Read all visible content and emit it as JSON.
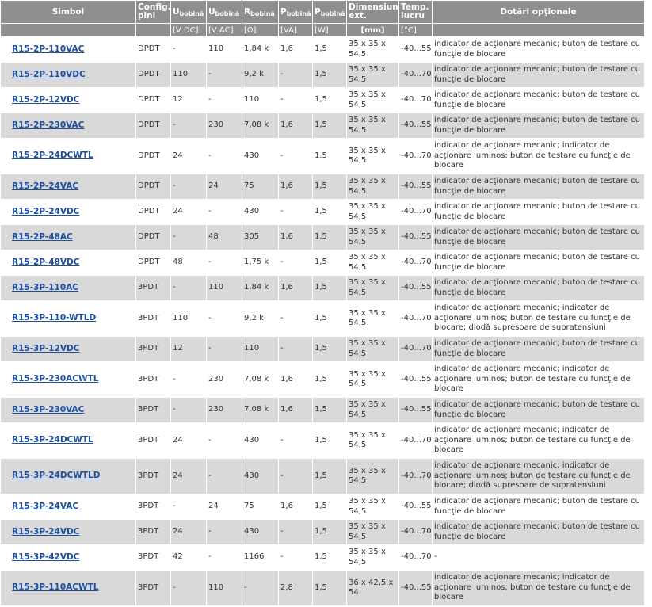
{
  "header": {
    "simbol": "Simbol",
    "config": "Config. pini",
    "u_dc_main": "U",
    "u_dc_sub": "bobină",
    "u_ac_main": "U",
    "u_ac_sub": "bobină",
    "r_main": "R",
    "r_sub": "bobină",
    "p_va_main": "P",
    "p_va_sub": "bobină",
    "p_w_main": "P",
    "p_w_sub": "bobină",
    "dim": "Dimensiuni ext.",
    "temp": "Temp. lucru",
    "dotari": "Dotări opţionale"
  },
  "units": {
    "simbol": "",
    "config": "",
    "u_dc": "[V DC]",
    "u_ac": "[V AC]",
    "r": "[Ω]",
    "p_va": "[VA]",
    "p_w": "[W]",
    "dim": "[mm]",
    "temp": "[°C]",
    "dotari": ""
  },
  "rows": [
    {
      "simbol": "R15-2P-110VAC",
      "config": "DPDT",
      "u_dc": "-",
      "u_ac": "110",
      "r": "1,84 k",
      "p_va": "1,6",
      "p_w": "1,5",
      "dim": "35 x 35 x 54,5",
      "temp": "-40...55",
      "dotari": "indicator de acţionare mecanic; buton de testare cu funcţie de blocare"
    },
    {
      "simbol": "R15-2P-110VDC",
      "config": "DPDT",
      "u_dc": "110",
      "u_ac": "-",
      "r": "9,2 k",
      "p_va": "-",
      "p_w": "1,5",
      "dim": "35 x 35 x 54,5",
      "temp": "-40...70",
      "dotari": "indicator de acţionare mecanic; buton de testare cu funcţie de blocare"
    },
    {
      "simbol": "R15-2P-12VDC",
      "config": "DPDT",
      "u_dc": "12",
      "u_ac": "-",
      "r": "110",
      "p_va": "-",
      "p_w": "1,5",
      "dim": "35 x 35 x 54,5",
      "temp": "-40...70",
      "dotari": "indicator de acţionare mecanic; buton de testare cu funcţie de blocare"
    },
    {
      "simbol": "R15-2P-230VAC",
      "config": "DPDT",
      "u_dc": "-",
      "u_ac": "230",
      "r": "7,08 k",
      "p_va": "1,6",
      "p_w": "1,5",
      "dim": "35 x 35 x 54,5",
      "temp": "-40...55",
      "dotari": "indicator de acţionare mecanic; buton de testare cu funcţie de blocare"
    },
    {
      "simbol": "R15-2P-24DCWTL",
      "config": "DPDT",
      "u_dc": "24",
      "u_ac": "-",
      "r": "430",
      "p_va": "-",
      "p_w": "1,5",
      "dim": "35 x 35 x 54,5",
      "temp": "-40...70",
      "dotari": "indicator de acţionare mecanic; indicator de acţionare luminos; buton de testare cu funcţie de blocare"
    },
    {
      "simbol": "R15-2P-24VAC",
      "config": "DPDT",
      "u_dc": "-",
      "u_ac": "24",
      "r": "75",
      "p_va": "1,6",
      "p_w": "1,5",
      "dim": "35 x 35 x 54,5",
      "temp": "-40...55",
      "dotari": "indicator de acţionare mecanic; buton de testare cu funcţie de blocare"
    },
    {
      "simbol": "R15-2P-24VDC",
      "config": "DPDT",
      "u_dc": "24",
      "u_ac": "-",
      "r": "430",
      "p_va": "-",
      "p_w": "1,5",
      "dim": "35 x 35 x 54,5",
      "temp": "-40...70",
      "dotari": "indicator de acţionare mecanic; buton de testare cu funcţie de blocare"
    },
    {
      "simbol": "R15-2P-48AC",
      "config": "DPDT",
      "u_dc": "-",
      "u_ac": "48",
      "r": "305",
      "p_va": "1,6",
      "p_w": "1,5",
      "dim": "35 x 35 x 54,5",
      "temp": "-40...55",
      "dotari": "indicator de acţionare mecanic; buton de testare cu funcţie de blocare"
    },
    {
      "simbol": "R15-2P-48VDC",
      "config": "DPDT",
      "u_dc": "48",
      "u_ac": "-",
      "r": "1,75 k",
      "p_va": "-",
      "p_w": "1,5",
      "dim": "35 x 35 x 54,5",
      "temp": "-40...70",
      "dotari": "indicator de acţionare mecanic; buton de testare cu funcţie de blocare"
    },
    {
      "simbol": "R15-3P-110AC",
      "config": "3PDT",
      "u_dc": "-",
      "u_ac": "110",
      "r": "1,84 k",
      "p_va": "1,6",
      "p_w": "1,5",
      "dim": "35 x 35 x 54,5",
      "temp": "-40...55",
      "dotari": "indicator de acţionare mecanic; buton de testare cu funcţie de blocare"
    },
    {
      "simbol": "R15-3P-110-WTLD",
      "config": "3PDT",
      "u_dc": "110",
      "u_ac": "-",
      "r": "9,2 k",
      "p_va": "-",
      "p_w": "1,5",
      "dim": "35 x 35 x 54,5",
      "temp": "-40...70",
      "dotari": "indicator de acţionare mecanic; indicator de acţionare luminos; buton de testare cu funcţie de blocare; diodă supresoare de supratensiuni"
    },
    {
      "simbol": "R15-3P-12VDC",
      "config": "3PDT",
      "u_dc": "12",
      "u_ac": "-",
      "r": "110",
      "p_va": "-",
      "p_w": "1,5",
      "dim": "35 x 35 x 54,5",
      "temp": "-40...70",
      "dotari": "indicator de acţionare mecanic; buton de testare cu funcţie de blocare"
    },
    {
      "simbol": "R15-3P-230ACWTL",
      "config": "3PDT",
      "u_dc": "-",
      "u_ac": "230",
      "r": "7,08 k",
      "p_va": "1,6",
      "p_w": "1,5",
      "dim": "35 x 35 x 54,5",
      "temp": "-40...55",
      "dotari": "indicator de acţionare mecanic; indicator de acţionare luminos; buton de testare cu funcţie de blocare"
    },
    {
      "simbol": "R15-3P-230VAC",
      "config": "3PDT",
      "u_dc": "-",
      "u_ac": "230",
      "r": "7,08 k",
      "p_va": "1,6",
      "p_w": "1,5",
      "dim": "35 x 35 x 54,5",
      "temp": "-40...55",
      "dotari": "indicator de acţionare mecanic; buton de testare cu funcţie de blocare"
    },
    {
      "simbol": "R15-3P-24DCWTL",
      "config": "3PDT",
      "u_dc": "24",
      "u_ac": "-",
      "r": "430",
      "p_va": "-",
      "p_w": "1,5",
      "dim": "35 x 35 x 54,5",
      "temp": "-40...70",
      "dotari": "indicator de acţionare mecanic; indicator de acţionare luminos; buton de testare cu funcţie de blocare"
    },
    {
      "simbol": "R15-3P-24DCWTLD",
      "config": "3PDT",
      "u_dc": "24",
      "u_ac": "-",
      "r": "430",
      "p_va": "-",
      "p_w": "1,5",
      "dim": "35 x 35 x 54,5",
      "temp": "-40...70",
      "dotari": "indicator de acţionare mecanic; indicator de acţionare luminos; buton de testare cu funcţie de blocare; diodă supresoare de supratensiuni"
    },
    {
      "simbol": "R15-3P-24VAC",
      "config": "3PDT",
      "u_dc": "-",
      "u_ac": "24",
      "r": "75",
      "p_va": "1,6",
      "p_w": "1,5",
      "dim": "35 x 35 x 54,5",
      "temp": "-40...55",
      "dotari": "indicator de acţionare mecanic; buton de testare cu funcţie de blocare"
    },
    {
      "simbol": "R15-3P-24VDC",
      "config": "3PDT",
      "u_dc": "24",
      "u_ac": "-",
      "r": "430",
      "p_va": "-",
      "p_w": "1,5",
      "dim": "35 x 35 x 54,5",
      "temp": "-40...70",
      "dotari": "indicator de acţionare mecanic; buton de testare cu funcţie de blocare"
    },
    {
      "simbol": "R15-3P-42VDC",
      "config": "3PDT",
      "u_dc": "42",
      "u_ac": "-",
      "r": "1166",
      "p_va": "-",
      "p_w": "1,5",
      "dim": "35 x 35 x 54,5",
      "temp": "-40...70",
      "dotari": "-"
    },
    {
      "simbol": "R15-3P-110ACWTL",
      "config": "3PDT",
      "u_dc": "-",
      "u_ac": "110",
      "r": "-",
      "p_va": "2,8",
      "p_w": "1,5",
      "dim": "36 x 42,5 x 54",
      "temp": "-40...55",
      "dotari": "indicator de acţionare mecanic; indicator de acţionare luminos; buton de testare cu funcţie de blocare"
    }
  ]
}
